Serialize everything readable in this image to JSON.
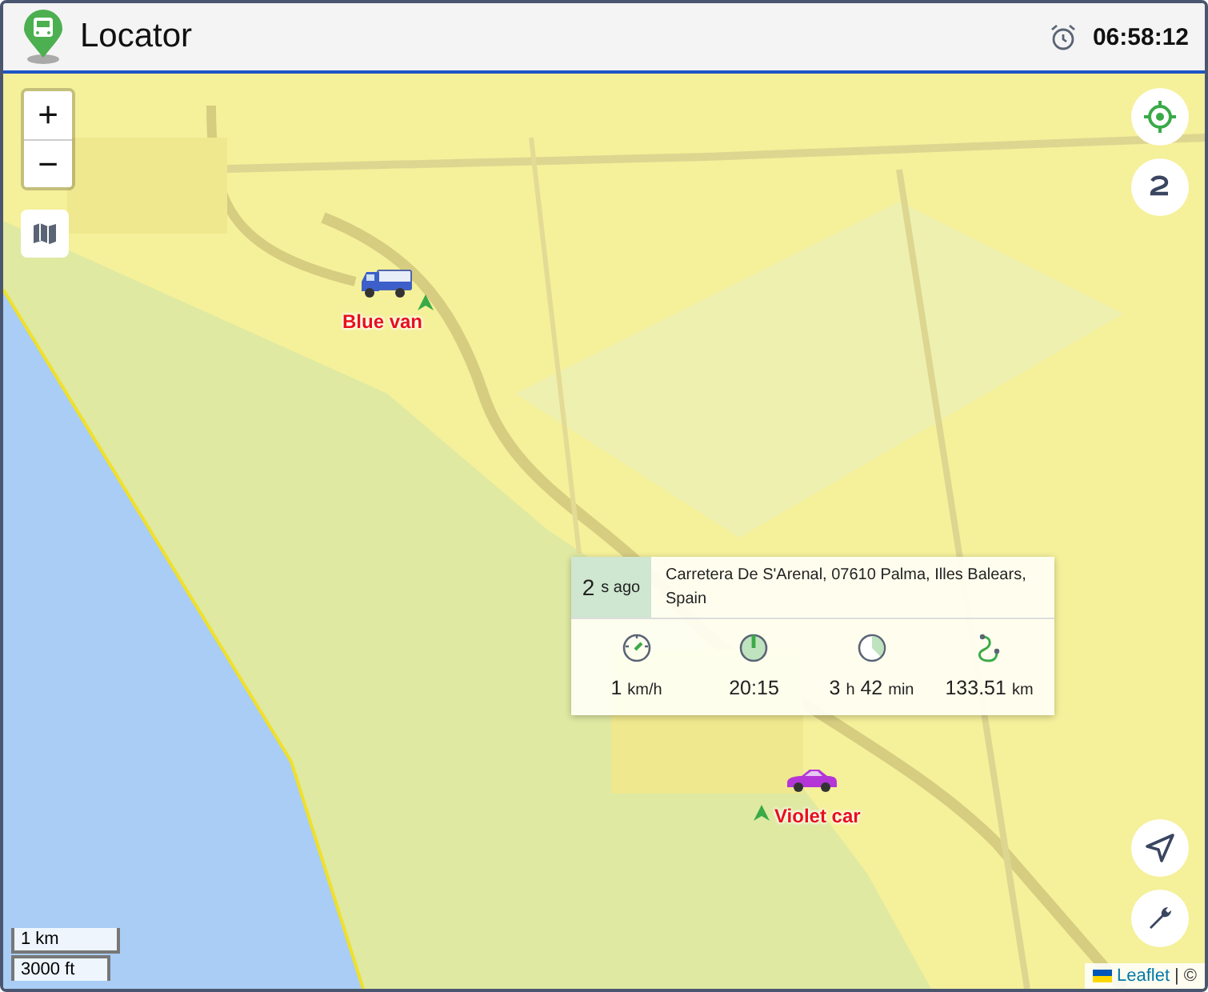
{
  "header": {
    "title": "Locator",
    "time": "06:58:12"
  },
  "zoom_controls": [
    {
      "label": "+"
    },
    {
      "label": "−"
    }
  ],
  "vehicles": [
    {
      "name": "Blue van",
      "kind": "van"
    },
    {
      "name": "Violet car",
      "kind": "car"
    }
  ],
  "popup": {
    "age": {
      "value": "2",
      "unit": "s ago"
    },
    "address": "Carretera De S'Arenal, 07610 Palma, Illes Balears, Spain",
    "stats": [
      {
        "kind": "speed",
        "parts": [
          {
            "value": "1",
            "unit": "km/h"
          }
        ]
      },
      {
        "kind": "time",
        "parts": [
          {
            "value": "20:15"
          }
        ]
      },
      {
        "kind": "duration",
        "parts": [
          {
            "value": "3",
            "unit": "h"
          },
          {
            "value": "42",
            "unit": "min"
          }
        ]
      },
      {
        "kind": "distance",
        "parts": [
          {
            "value": "133.51",
            "unit": "km"
          }
        ]
      }
    ]
  },
  "scale": [
    "1 km",
    "3000 ft"
  ],
  "attribution": {
    "link": "Leaflet",
    "separator": "|",
    "copyright": "©"
  }
}
